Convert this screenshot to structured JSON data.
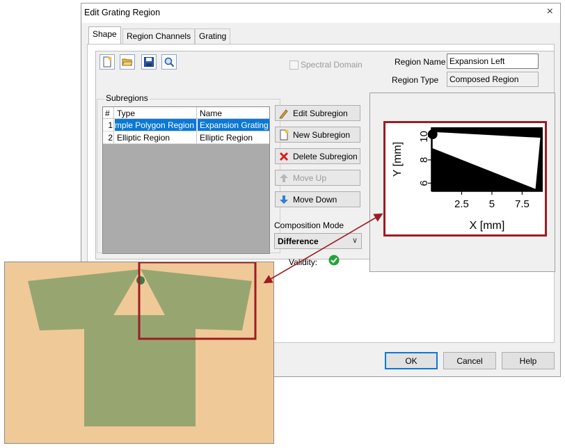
{
  "dialog": {
    "title": "Edit Grating Region",
    "close_glyph": "×"
  },
  "tabs": [
    {
      "label": "Shape",
      "active": true
    },
    {
      "label": "Region Channels",
      "active": false
    },
    {
      "label": "Grating",
      "active": false
    }
  ],
  "toolbar": {
    "icons": [
      "new-document-icon",
      "open-folder-icon",
      "save-disk-icon",
      "magnifier-icon"
    ]
  },
  "spectral_domain": {
    "label": "Spectral Domain",
    "checked": false,
    "enabled": false
  },
  "region": {
    "name_label": "Region Name",
    "name_value": "Expansion Left",
    "type_label": "Region Type",
    "type_value": "Composed Region"
  },
  "subregions": {
    "group_label": "Subregions",
    "columns": [
      "#",
      "Type",
      "Name"
    ],
    "rows": [
      {
        "index": "1",
        "type": "Simple Polygon Region",
        "name": "Expansion Grating",
        "selected": true
      },
      {
        "index": "2",
        "type": "Elliptic Region",
        "name": "Elliptic Region",
        "selected": false
      }
    ]
  },
  "buttons": {
    "edit": "Edit Subregion",
    "new": "New Subregion",
    "delete": "Delete Subregion",
    "move_up": "Move Up",
    "move_down": "Move Down"
  },
  "composition": {
    "label": "Composition Mode",
    "value": "Difference",
    "validity_label": "Validity:"
  },
  "footer": {
    "ok": "OK",
    "cancel": "Cancel",
    "help": "Help"
  },
  "chart_data": {
    "type": "scatter",
    "title": "",
    "xlabel": "X [mm]",
    "ylabel": "Y [mm]",
    "x_ticks": [
      "2.5",
      "5",
      "7.5"
    ],
    "y_ticks": [
      "6",
      "8",
      "10"
    ],
    "xlim": [
      0,
      9.2
    ],
    "ylim": [
      5.3,
      10.8
    ],
    "series": [
      {
        "shape": "polygon",
        "fill": "#ffffff",
        "points": [
          [
            0.1,
            10.4
          ],
          [
            9.0,
            9.9
          ],
          [
            8.6,
            5.5
          ],
          [
            0.1,
            9.0
          ]
        ]
      },
      {
        "shape": "circle",
        "fill": "#000000",
        "center": [
          0.1,
          10.2
        ],
        "radius": 0.4
      }
    ],
    "background": "#000000"
  },
  "colors": {
    "accent": "#0a78d7",
    "annotation": "#9d1c24",
    "sketch_background": "#f0c999",
    "sketch_shape": "#97a670",
    "sketch_dot": "#3d7a4e",
    "validity": "#22a33a"
  }
}
